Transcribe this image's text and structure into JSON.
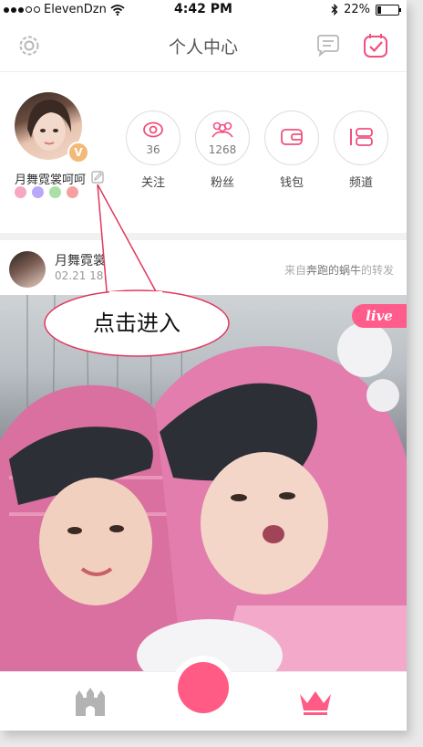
{
  "status_bar": {
    "carrier": "ElevenDzn",
    "time": "4:42 PM",
    "battery": "22%",
    "battery_level": 0.22
  },
  "nav": {
    "title": "个人中心"
  },
  "profile": {
    "username": "月舞霓裳呵呵",
    "badge": "V",
    "color_dots": [
      "#f7a7c0",
      "#b9a8f7",
      "#a9e0a6",
      "#f7a0a0"
    ],
    "stats": [
      {
        "count": "36",
        "label": "关注"
      },
      {
        "count": "1268",
        "label": "粉丝"
      },
      {
        "count": "",
        "label": "钱包"
      },
      {
        "count": "",
        "label": "频道"
      }
    ]
  },
  "post": {
    "author": "月舞霓裳",
    "date": "02.21   18:36",
    "source_prefix": "来自",
    "source_name": "奔跑的蜗牛",
    "source_suffix": "的转发",
    "live_label": "live"
  },
  "callout": {
    "text": "点击进入"
  },
  "colors": {
    "accent": "#ff5b84",
    "icon_pink": "#f0507f"
  }
}
